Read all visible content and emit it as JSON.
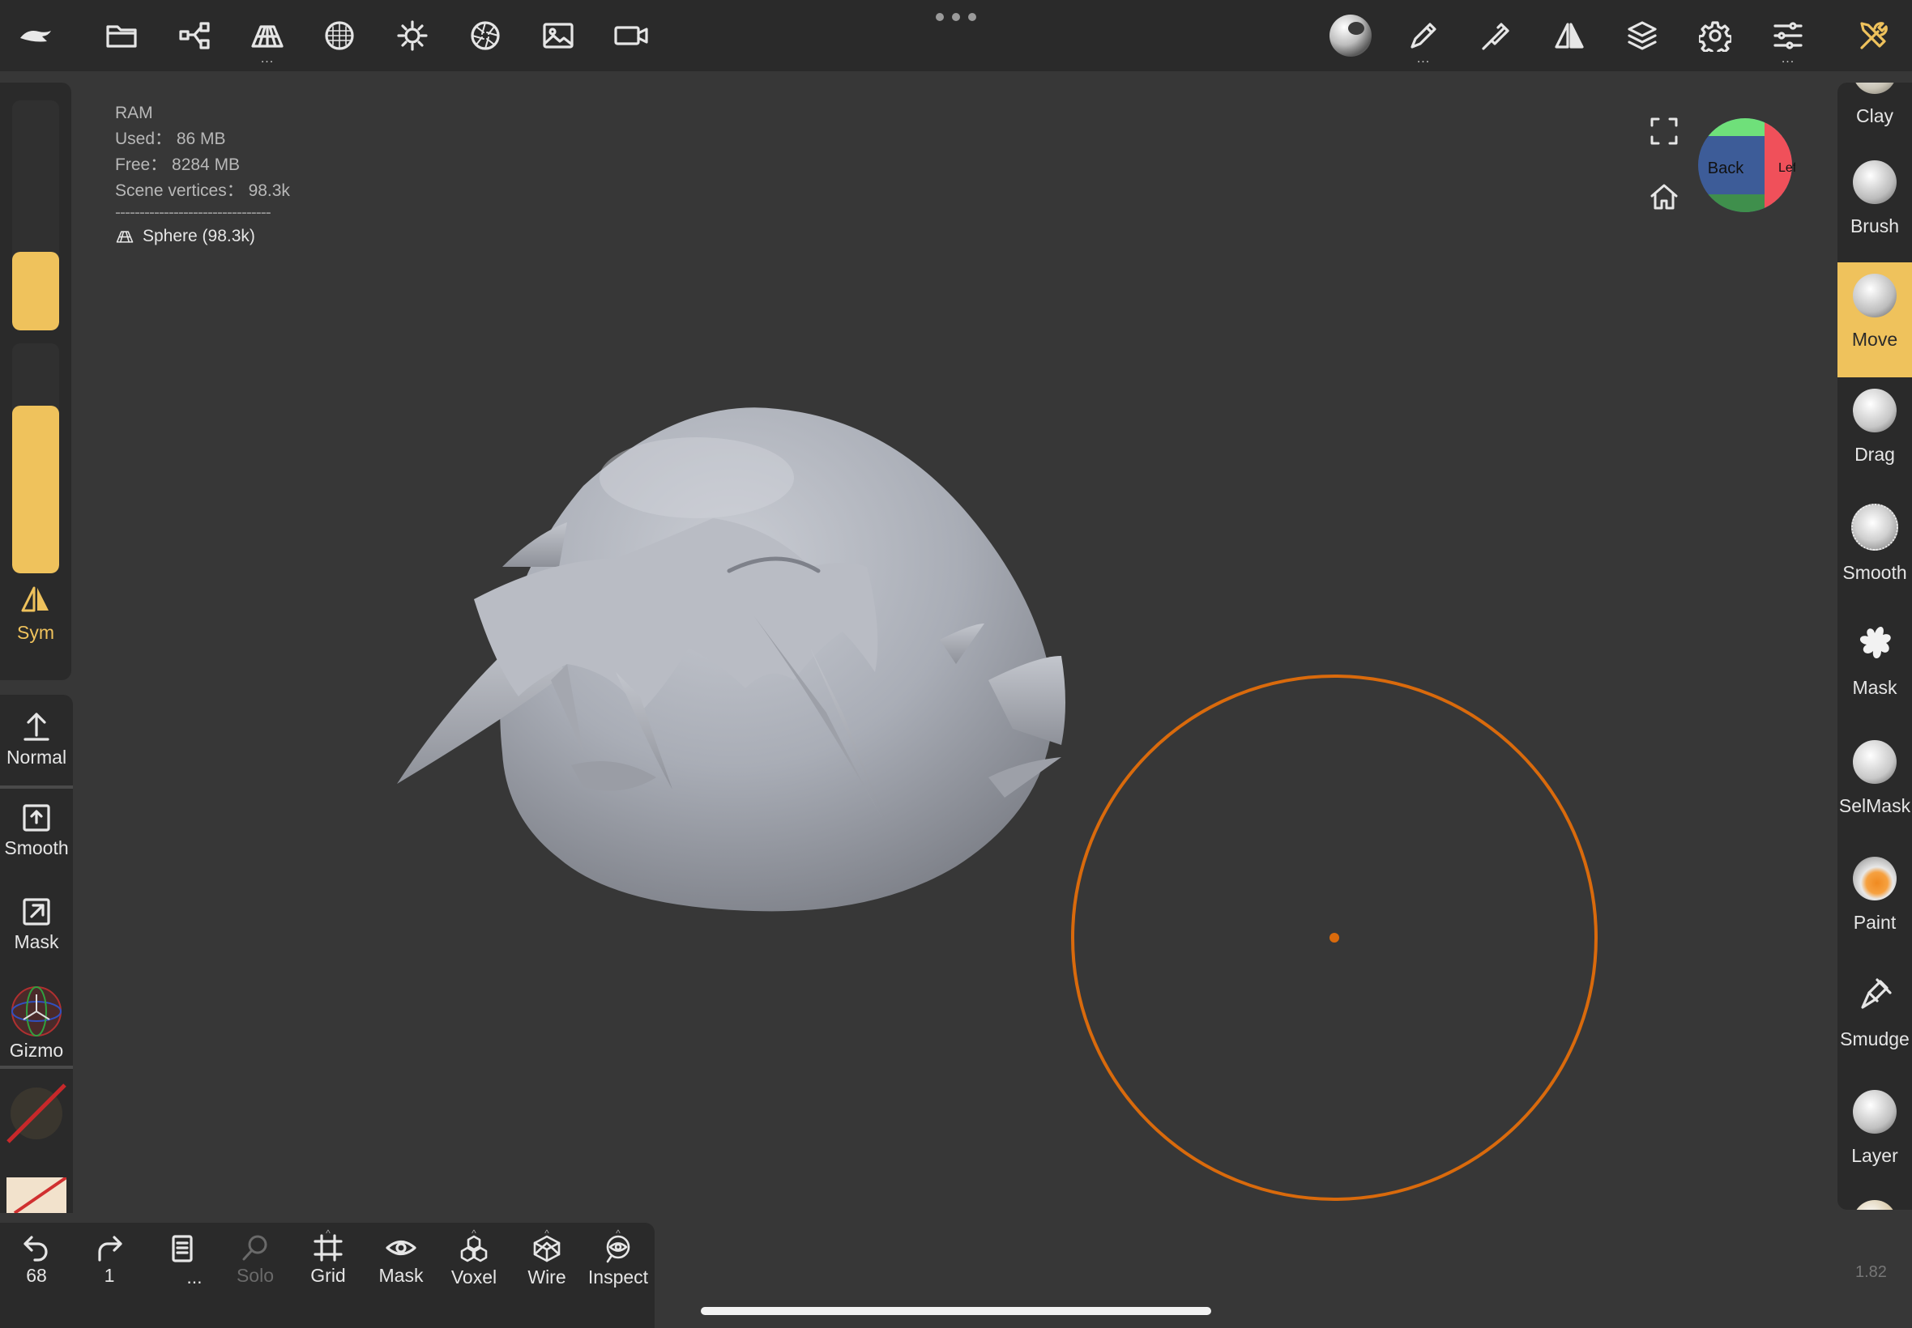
{
  "top_toolbar": {
    "left_icons": [
      "app-logo-icon",
      "folder-icon",
      "scene-graph-icon",
      "topology-icon",
      "material-sphere-icon",
      "light-icon",
      "aperture-icon",
      "image-icon",
      "camera-icon"
    ],
    "right_icons": [
      "material-ball-icon",
      "paint-brush-icon",
      "stroke-icon",
      "symmetry-icon",
      "layers-icon",
      "settings-icon",
      "sliders-icon",
      "tools-icon"
    ],
    "more_dots": "..."
  },
  "info": {
    "ram_label": "RAM",
    "used": "Used： 86 MB",
    "free": "Free： 8284 MB",
    "vertices": "Scene vertices： 98.3k",
    "separator": "--------------------------------",
    "object": "Sphere (98.3k)"
  },
  "left_panel": {
    "sym_label": "Sym",
    "radius_fraction": 0.34,
    "intensity_fraction": 0.73,
    "items": [
      {
        "label": "Normal"
      },
      {
        "label": "Smooth"
      },
      {
        "label": "Mask"
      },
      {
        "label": "Gizmo"
      }
    ]
  },
  "tools": [
    {
      "label": "Clay"
    },
    {
      "label": "Brush"
    },
    {
      "label": "Move",
      "active": true
    },
    {
      "label": "Drag"
    },
    {
      "label": "Smooth"
    },
    {
      "label": "Mask"
    },
    {
      "label": "SelMask"
    },
    {
      "label": "Paint"
    },
    {
      "label": "Smudge"
    },
    {
      "label": "Layer"
    }
  ],
  "bottom_bar": {
    "undo_count": "68",
    "redo_count": "1",
    "menu_dots": "...",
    "buttons": [
      {
        "label": "Solo",
        "disabled": true
      },
      {
        "label": "Grid"
      },
      {
        "label": "Mask"
      },
      {
        "label": "Voxel"
      },
      {
        "label": "Wire"
      },
      {
        "label": "Inspect"
      }
    ]
  },
  "view_cube": {
    "front_face": "Back",
    "side_face": "Left"
  },
  "version": "1.82",
  "colors": {
    "accent": "#efc25c",
    "brush_cursor": "#d96a0c",
    "panel": "#2a2a2a",
    "viewport": "#373737"
  }
}
